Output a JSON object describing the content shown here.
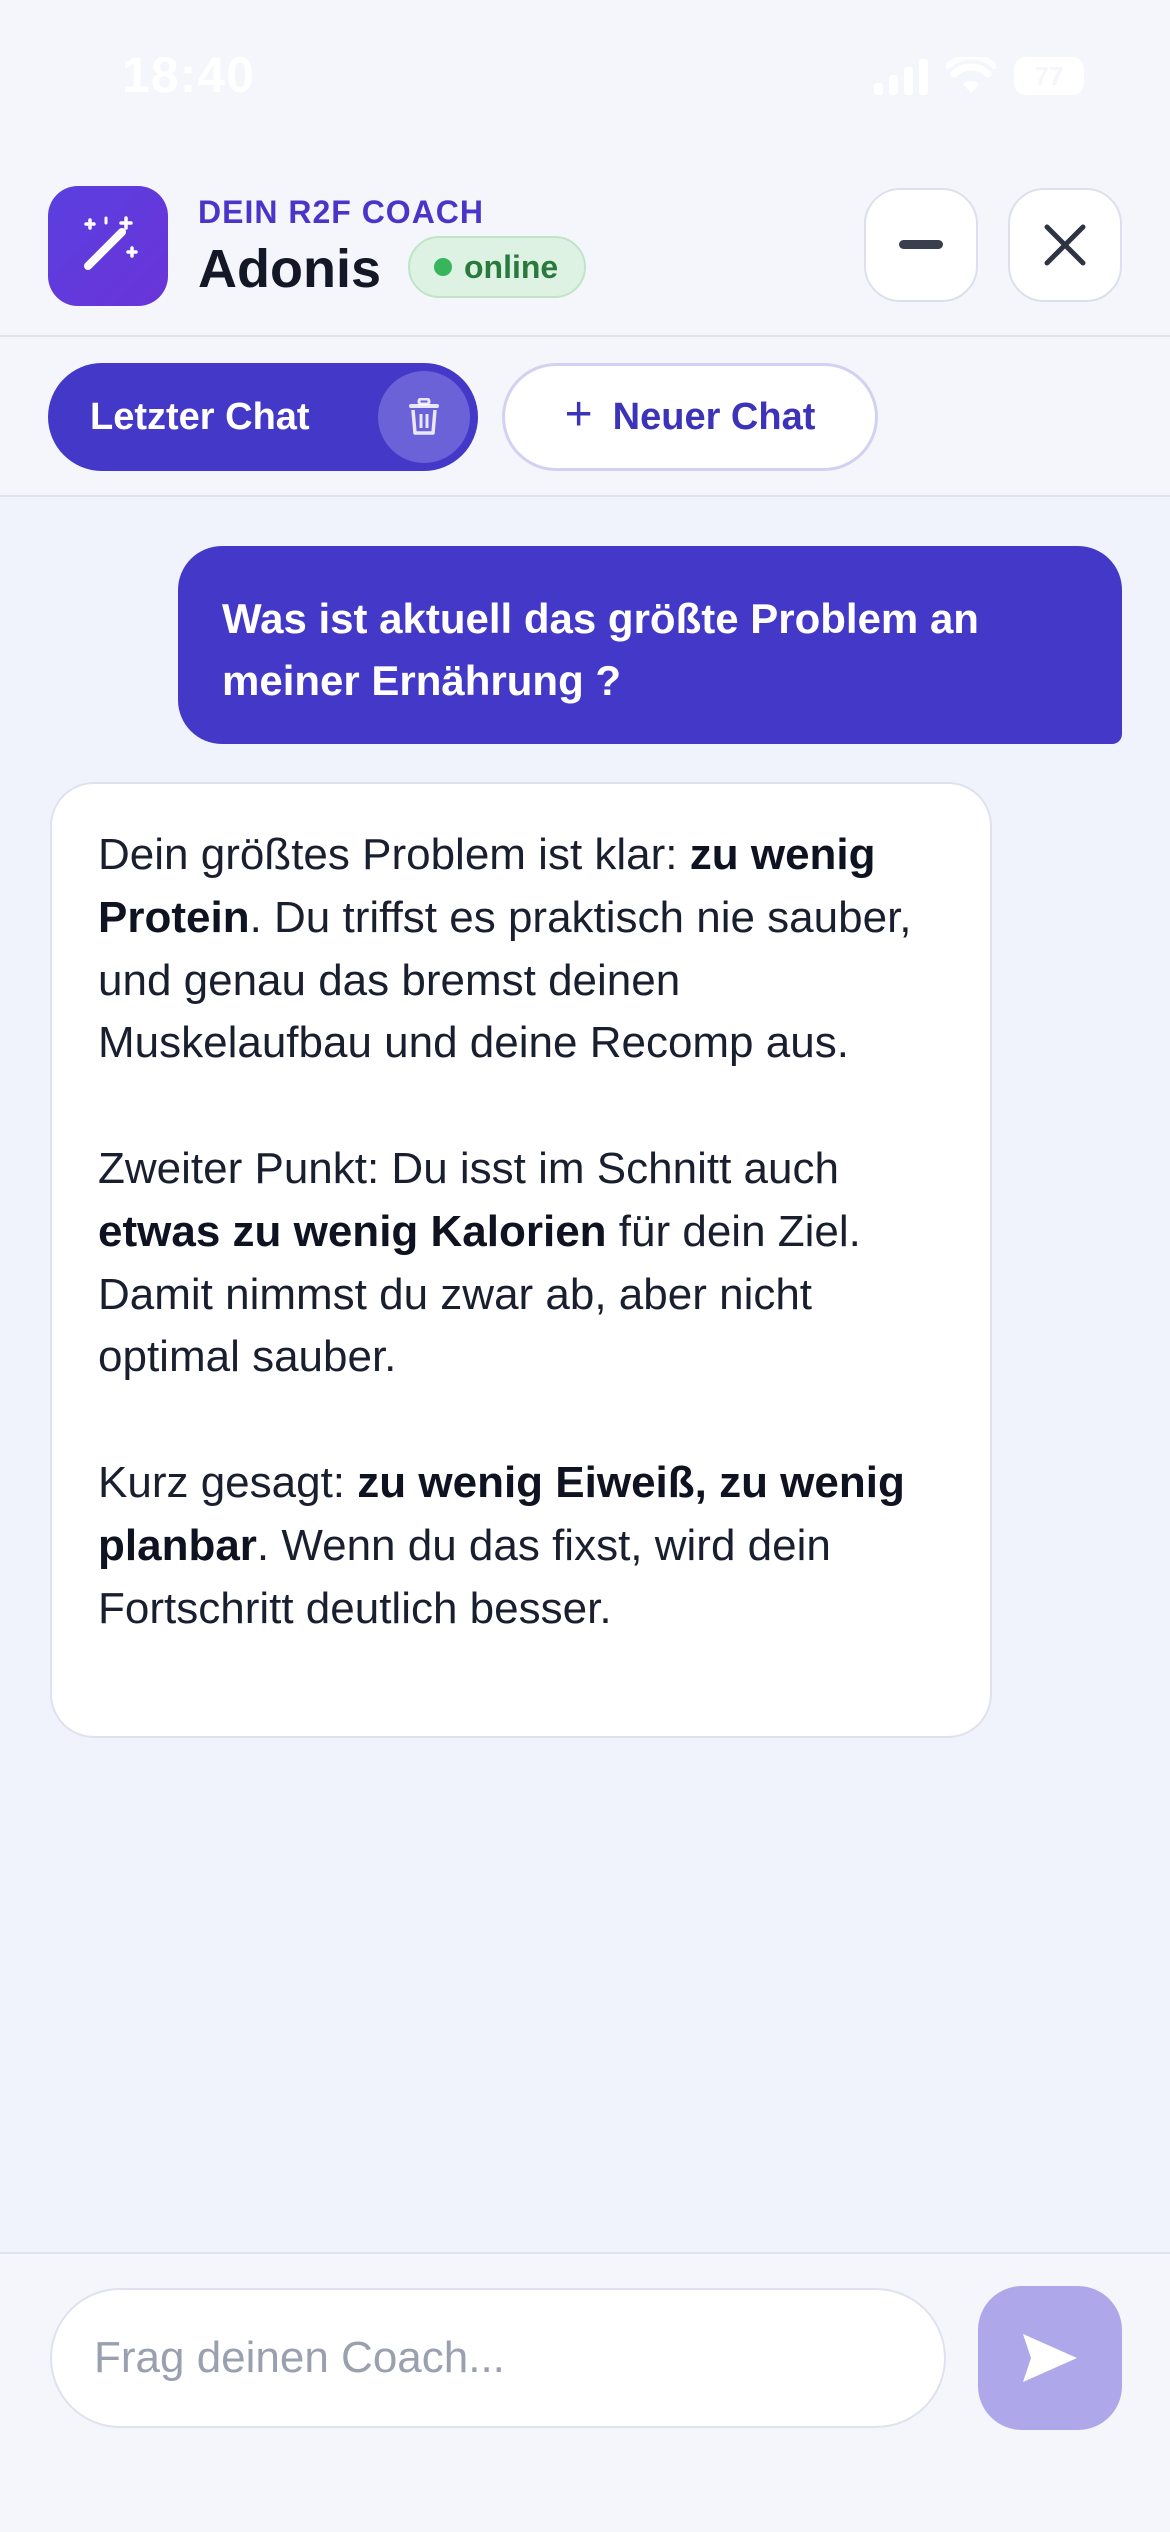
{
  "status_bar": {
    "time": "18:40",
    "battery": "77"
  },
  "header": {
    "kicker": "DEIN R2F COACH",
    "name": "Adonis",
    "status": "online",
    "icon": "magic-wand-icon"
  },
  "tabs": {
    "active_label": "Letzter Chat",
    "new_plus": "+",
    "new_label": "Neuer Chat"
  },
  "messages": {
    "user": "Was ist aktuell das größte Problem an meiner Ernährung ?",
    "bot": {
      "p1_a": "Dein größtes Problem ist klar: ",
      "p1_b": "zu wenig Protein",
      "p1_c": ". Du triffst es praktisch nie sauber, und genau das bremst deinen Muskelaufbau und deine Recomp aus.",
      "p2_a": "Zweiter Punkt: Du isst im Schnitt auch ",
      "p2_b": "etwas zu wenig Kalorien",
      "p2_c": " für dein Ziel. Damit nimmst du zwar ab, aber nicht optimal sauber.",
      "p3_a": "Kurz gesagt: ",
      "p3_b": "zu wenig Eiweiß, zu wenig planbar",
      "p3_c": ". Wenn du das fixst, wird dein Fortschritt deutlich besser."
    }
  },
  "composer": {
    "placeholder": "Frag deinen Coach..."
  },
  "colors": {
    "accent": "#4338c7",
    "online": "#36b55a",
    "send_disabled": "#aea8ea"
  }
}
